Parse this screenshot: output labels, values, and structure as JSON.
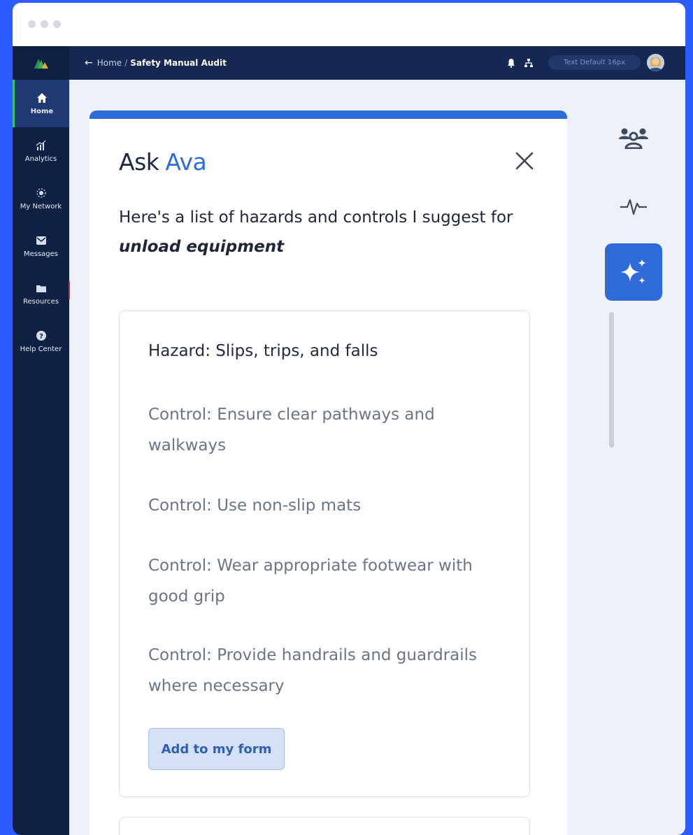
{
  "window": {
    "dots": 3
  },
  "sidebar": {
    "items": [
      {
        "label": "Home",
        "icon": "home-icon",
        "active": true
      },
      {
        "label": "Analytics",
        "icon": "analytics-icon"
      },
      {
        "label": "My Network",
        "icon": "network-icon"
      },
      {
        "label": "Messages",
        "icon": "mail-icon"
      },
      {
        "label": "Resources",
        "icon": "folder-icon"
      },
      {
        "label": "Help Center",
        "icon": "help-icon"
      }
    ]
  },
  "topbar": {
    "back_icon": "←",
    "home": "Home",
    "separator": "/",
    "current": "Safety Manual Audit",
    "pill": "Text Default 16px"
  },
  "panel": {
    "title_prefix": "Ask",
    "title_name": "Ava",
    "intro": "Here's a list of hazards and controls I suggest for",
    "task": "unload equipment",
    "card": {
      "hazard": "Hazard: Slips, trips, and falls",
      "controls": [
        "Control: Ensure clear pathways and walkways",
        "Control: Use non-slip mats",
        "Control: Wear appropriate footwear with good grip",
        "Control: Provide handrails and guardrails where necessary"
      ],
      "button": "Add to my form"
    }
  },
  "colors": {
    "accent": "#2f6bd8",
    "sidebar": "#0f2142",
    "topbar": "#142852",
    "frame": "#2b5cff"
  }
}
